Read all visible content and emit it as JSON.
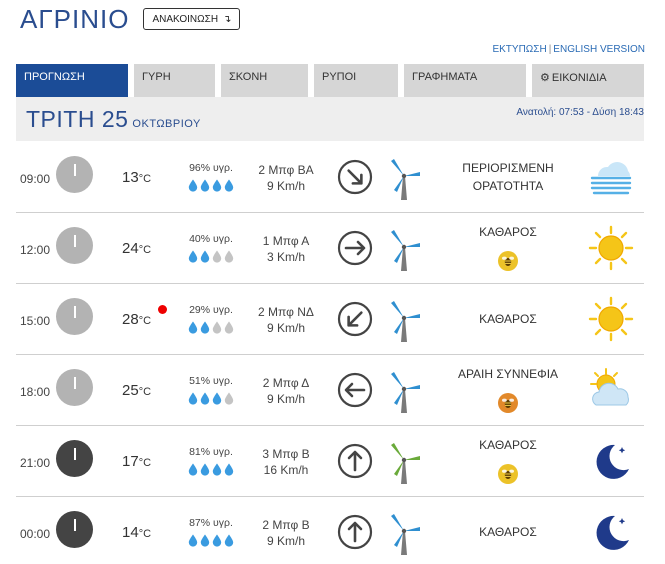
{
  "header": {
    "city": "ΑΓΡΙΝΙΟ",
    "announce_label": "ΑΝΑΚΟΙΝΩΣΗ"
  },
  "links": {
    "print": "ΕΚΤΥΠΩΣΗ",
    "separator": "|",
    "english": "ENGLISH VERSION"
  },
  "tabs": [
    {
      "label": "ΠΡΟΓΝΩΣΗ"
    },
    {
      "label": "ΓΥΡΗ"
    },
    {
      "label": "ΣΚΟΝΗ"
    },
    {
      "label": "ΡΥΠΟΙ"
    },
    {
      "label": "ΓΡΑΦΗΜΑΤΑ"
    },
    {
      "label": "ΕΙΚΟΝΙΔΙΑ"
    }
  ],
  "day": {
    "name": "ΤΡΙΤΗ 25",
    "month": "ΟΚΤΩΒΡΙΟΥ",
    "sun": "Ανατολή: 07:53 - Δύση 18:43"
  },
  "temp_unit": "°C",
  "rows": [
    {
      "time": "09:00",
      "hour": 9,
      "night": false,
      "temp": "13",
      "hot": false,
      "humidity": "96% υγρ.",
      "drops": 4,
      "wind_force": "2 Μπφ ΒΑ",
      "wind_speed": "9 Km/h",
      "wind_arrow_deg": 225,
      "turbine": "blue",
      "cond_lines": [
        "ΠΕΡΙΟΡΙΣΜΕΝΗ",
        "ΟΡΑΤΟΤΗΤΑ"
      ],
      "bee": "",
      "weather_icon": "fog-icon"
    },
    {
      "time": "12:00",
      "hour": 12,
      "night": false,
      "temp": "24",
      "hot": false,
      "humidity": "40% υγρ.",
      "drops": 2,
      "wind_force": "1 Μπφ Α",
      "wind_speed": "3 Km/h",
      "wind_arrow_deg": 180,
      "turbine": "blue",
      "cond_lines": [
        "ΚΑΘΑΡΟΣ"
      ],
      "bee": "yellow",
      "weather_icon": "sun-icon"
    },
    {
      "time": "15:00",
      "hour": 15,
      "night": false,
      "temp": "28",
      "hot": true,
      "humidity": "29% υγρ.",
      "drops": 2,
      "wind_force": "2 Μπφ ΝΔ",
      "wind_speed": "9 Km/h",
      "wind_arrow_deg": 315,
      "turbine": "blue",
      "cond_lines": [
        "ΚΑΘΑΡΟΣ"
      ],
      "bee": "",
      "weather_icon": "sun-icon"
    },
    {
      "time": "18:00",
      "hour": 18,
      "night": false,
      "temp": "25",
      "hot": false,
      "humidity": "51% υγρ.",
      "drops": 3,
      "wind_force": "2 Μπφ Δ",
      "wind_speed": "9 Km/h",
      "wind_arrow_deg": 0,
      "turbine": "blue",
      "cond_lines": [
        "ΑΡΑΙΗ ΣΥΝΝΕΦΙΑ"
      ],
      "bee": "orange",
      "weather_icon": "sun-cloud-icon"
    },
    {
      "time": "21:00",
      "hour": 21,
      "night": true,
      "temp": "17",
      "hot": false,
      "humidity": "81% υγρ.",
      "drops": 4,
      "wind_force": "3 Μπφ Β",
      "wind_speed": "16 Km/h",
      "wind_arrow_deg": 90,
      "turbine": "green",
      "cond_lines": [
        "ΚΑΘΑΡΟΣ"
      ],
      "bee": "yellow",
      "weather_icon": "moon-icon"
    },
    {
      "time": "00:00",
      "hour": 0,
      "night": true,
      "temp": "14",
      "hot": false,
      "humidity": "87% υγρ.",
      "drops": 4,
      "wind_force": "2 Μπφ Β",
      "wind_speed": "9 Km/h",
      "wind_arrow_deg": 90,
      "turbine": "blue",
      "cond_lines": [
        "ΚΑΘΑΡΟΣ"
      ],
      "bee": "",
      "weather_icon": "moon-icon"
    }
  ],
  "colors": {
    "brand_blue": "#2a4d8f",
    "tab_active": "#1b4c97",
    "tab_inactive": "#d6d6d6",
    "drop_full": "#3a9be0",
    "drop_empty": "#c4c4c4",
    "sun": "#f5c518",
    "moon": "#1f3a8a",
    "turbine_blue": "#2f8fd0",
    "turbine_green": "#6aaa3a",
    "hot_dot": "#e00000"
  }
}
